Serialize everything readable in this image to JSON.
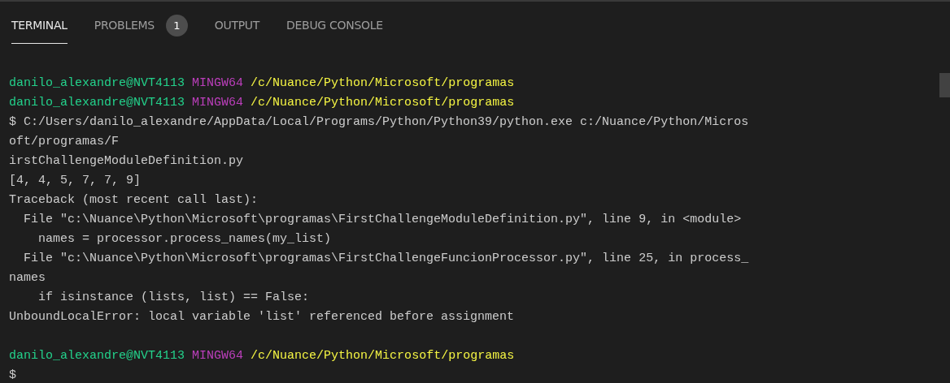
{
  "tabs": [
    {
      "label": "TERMINAL",
      "selected": true
    },
    {
      "label": "PROBLEMS",
      "selected": false,
      "badge": "1"
    },
    {
      "label": "OUTPUT",
      "selected": false
    },
    {
      "label": "DEBUG CONSOLE",
      "selected": false
    }
  ],
  "terminal": {
    "lines": [
      {
        "kind": "prompt",
        "user": "danilo_alexandre@NVT4113",
        "shell": "MINGW64",
        "path": "/c/Nuance/Python/Microsoft/programas"
      },
      {
        "kind": "prompt",
        "user": "danilo_alexandre@NVT4113",
        "shell": "MINGW64",
        "path": "/c/Nuance/Python/Microsoft/programas"
      },
      {
        "kind": "text",
        "text": "$ C:/Users/danilo_alexandre/AppData/Local/Programs/Python/Python39/python.exe c:/Nuance/Python/Micros"
      },
      {
        "kind": "text",
        "text": "oft/programas/F"
      },
      {
        "kind": "text",
        "text": "irstChallengeModuleDefinition.py"
      },
      {
        "kind": "text",
        "text": "[4, 4, 5, 7, 7, 9]"
      },
      {
        "kind": "text",
        "text": "Traceback (most recent call last):"
      },
      {
        "kind": "text",
        "text": "  File \"c:\\Nuance\\Python\\Microsoft\\programas\\FirstChallengeModuleDefinition.py\", line 9, in <module>"
      },
      {
        "kind": "text",
        "text": "    names = processor.process_names(my_list)"
      },
      {
        "kind": "text",
        "text": "  File \"c:\\Nuance\\Python\\Microsoft\\programas\\FirstChallengeFuncionProcessor.py\", line 25, in process_"
      },
      {
        "kind": "text",
        "text": "names"
      },
      {
        "kind": "text",
        "text": "    if isinstance (lists, list) == False:"
      },
      {
        "kind": "text",
        "text": "UnboundLocalError: local variable 'list' referenced before assignment"
      },
      {
        "kind": "blank"
      },
      {
        "kind": "prompt",
        "user": "danilo_alexandre@NVT4113",
        "shell": "MINGW64",
        "path": "/c/Nuance/Python/Microsoft/programas"
      },
      {
        "kind": "text",
        "text": "$"
      }
    ]
  }
}
